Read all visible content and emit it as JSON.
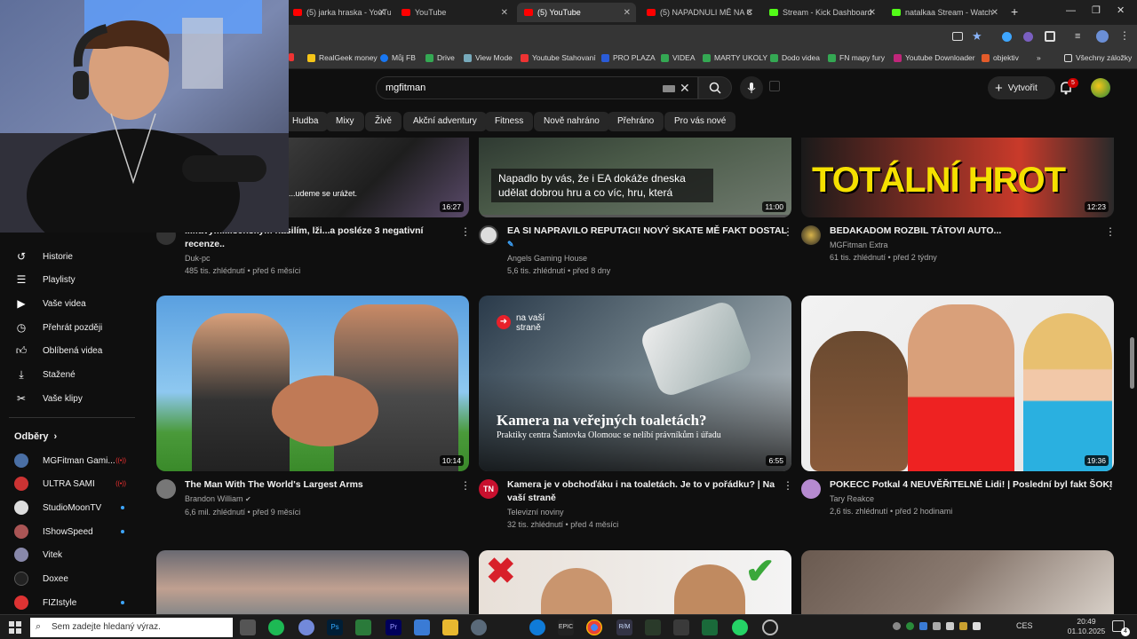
{
  "browser": {
    "tabs": [
      {
        "label": "(5) jarka hraska - YouTube",
        "color": "#ff0000"
      },
      {
        "label": "YouTube",
        "color": "#ff0000"
      },
      {
        "label": "(5) YouTube",
        "color": "#ff0000",
        "active": true
      },
      {
        "label": "(5) NAPADNULI MĚ NA C",
        "color": "#ff0000"
      },
      {
        "label": "Stream - Kick Dashboard",
        "color": "#53fc18"
      },
      {
        "label": "natalkaa Stream - Watch",
        "color": "#53fc18"
      }
    ],
    "bookmarks": [
      {
        "label": "RealGeek money",
        "color": "#f5c518"
      },
      {
        "label": "Můj FB",
        "color": "#1877f2"
      },
      {
        "label": "Drive",
        "color": "#34a853"
      },
      {
        "label": "View Mode",
        "color": "#7ab"
      },
      {
        "label": "Youtube Stahovaní",
        "color": "#e33"
      },
      {
        "label": "PRO PLAZA",
        "color": "#2a5bd7"
      },
      {
        "label": "VIDEA",
        "color": "#34a853"
      },
      {
        "label": "MARTY UKOLY",
        "color": "#34a853"
      },
      {
        "label": "Dodo videa",
        "color": "#34a853"
      },
      {
        "label": "FN mapy fury",
        "color": "#34a853"
      },
      {
        "label": "Youtube Downloader",
        "color": "#c0267a"
      },
      {
        "label": "objektiv",
        "color": "#e35b2a"
      }
    ],
    "all_bookmarks": "Všechny záložky"
  },
  "youtube": {
    "search_value": "mgfitman",
    "create_label": "Vytvořit",
    "notif_count": "5",
    "chips": [
      "Hudba",
      "Mixy",
      "Živě",
      "Akční adventury",
      "Fitness",
      "Nově nahráno",
      "Přehráno",
      "Pro vás nové"
    ],
    "sidebar": {
      "items": [
        {
          "label": "Historie",
          "icon": "history-icon"
        },
        {
          "label": "Playlisty",
          "icon": "playlist-icon"
        },
        {
          "label": "Vaše videa",
          "icon": "video-icon"
        },
        {
          "label": "Přehrát později",
          "icon": "clock-icon"
        },
        {
          "label": "Oblíbená videa",
          "icon": "thumb-up-icon"
        },
        {
          "label": "Stažené",
          "icon": "download-icon"
        },
        {
          "label": "Vaše klipy",
          "icon": "scissors-icon"
        }
      ],
      "subs_header": "Odběry",
      "subs": [
        {
          "label": "MGFitman Gami...",
          "color": "#4a6fa5"
        },
        {
          "label": "ULTRA SAMI",
          "color": "#c33"
        },
        {
          "label": "StudioMoonTV",
          "color": "#ddd"
        },
        {
          "label": "IShowSpeed",
          "color": "#a55"
        },
        {
          "label": "Vitek",
          "color": "#88a"
        },
        {
          "label": "Doxee",
          "color": "#222"
        },
        {
          "label": "FIZIstyle",
          "color": "#d33"
        }
      ]
    },
    "row1": [
      {
        "title_l1": "...lfavým...lšenským násilím, lži...a posléze 3 negativní",
        "title_l2": "recenze..",
        "channel": "Duk-pc",
        "stats": "485 tis. zhlédnutí • před 6 měsíci",
        "duration": "16:27",
        "overlay": "...udeme se urážet."
      },
      {
        "title_l1": "EA SI NAPRAVILO REPUTACI! NOVÝ SKATE MĚ FAKT DOSTAL",
        "title_l2": "",
        "channel": "Angels Gaming House",
        "stats": "5,6 tis. zhlédnutí • před 8 dny",
        "duration": "11:00",
        "overlay": "Napadlo by vás, že i EA dokáže dneska udělat dobrou hru a co víc, hru, která"
      },
      {
        "title_l1": "BEDAKADOM ROZBIL TÁTOVI AUTO...",
        "title_l2": "",
        "channel": "MGFitman Extra",
        "stats": "61 tis. zhlédnutí • před 2 týdny",
        "duration": "12:23",
        "overlay": "TOTÁLNÍ HROT"
      }
    ],
    "row2": [
      {
        "title_l1": "The Man With The World's Largest Arms",
        "title_l2": "",
        "channel": "Brandon William",
        "stats": "6,6 mil. zhlédnutí • před 9 měsíci",
        "duration": "10:14"
      },
      {
        "title_l1": "Kamera je v obchoďáku i na toaletách. Je to v pořádku? | Na",
        "title_l2": "vaší straně",
        "channel": "Televizní noviny",
        "stats": "32 tis. zhlédnutí • před 4 měsíci",
        "duration": "6:55",
        "badge": "na vaší straně",
        "overlay_title": "Kamera na veřejných toaletách?",
        "overlay_sub": "Praktiky centra Šantovka Olomouc se nelíbí právníkům i úřadu",
        "avatar_text": "TN"
      },
      {
        "title_l1": "POKECC Potkal 4 NEUVĚŘITELNÉ Lidi! | Poslední byl fakt ŠOK!",
        "title_l2": "",
        "channel": "Tary Reakce",
        "stats": "2,6 tis. zhlédnutí • před 2 hodinami",
        "duration": "19:36"
      }
    ]
  },
  "taskbar": {
    "search_placeholder": "Sem zadejte hledaný výraz.",
    "lang": "CES",
    "time": "20:49",
    "date": "01.10.2025",
    "notif": "4"
  }
}
